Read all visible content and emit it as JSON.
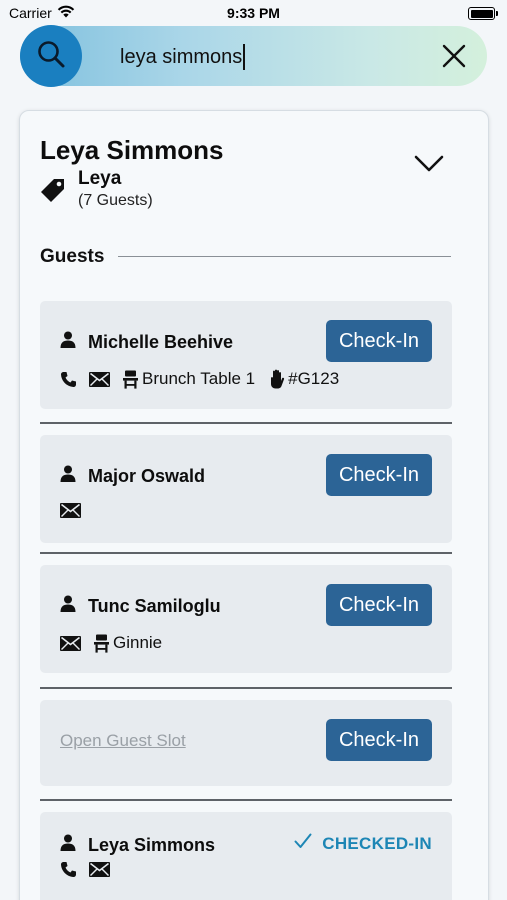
{
  "status_bar": {
    "carrier": "Carrier",
    "time": "9:33 PM"
  },
  "search": {
    "query": "leya simmons"
  },
  "party": {
    "name": "Leya Simmons",
    "tag_label": "Leya",
    "guest_count": "(7 Guests)"
  },
  "guests_heading": "Guests",
  "guests": [
    {
      "name": "Michelle Beehive",
      "has_phone": true,
      "has_email": true,
      "table": "Brunch Table 1",
      "code": "#G123",
      "action": "Check-In"
    },
    {
      "name": "Major Oswald",
      "has_phone": false,
      "has_email": true,
      "action": "Check-In"
    },
    {
      "name": "Tunc Samiloglu",
      "has_phone": false,
      "has_email": true,
      "table": "Ginnie",
      "action": "Check-In"
    },
    {
      "name": "Open Guest Slot",
      "open_slot": true,
      "action": "Check-In"
    },
    {
      "name": "Leya Simmons",
      "has_phone": true,
      "has_email": true,
      "status": "CHECKED-IN"
    }
  ],
  "colors": {
    "accent": "#2c6496",
    "search_button": "#1a7fc0",
    "checked_in": "#1d86b5"
  }
}
